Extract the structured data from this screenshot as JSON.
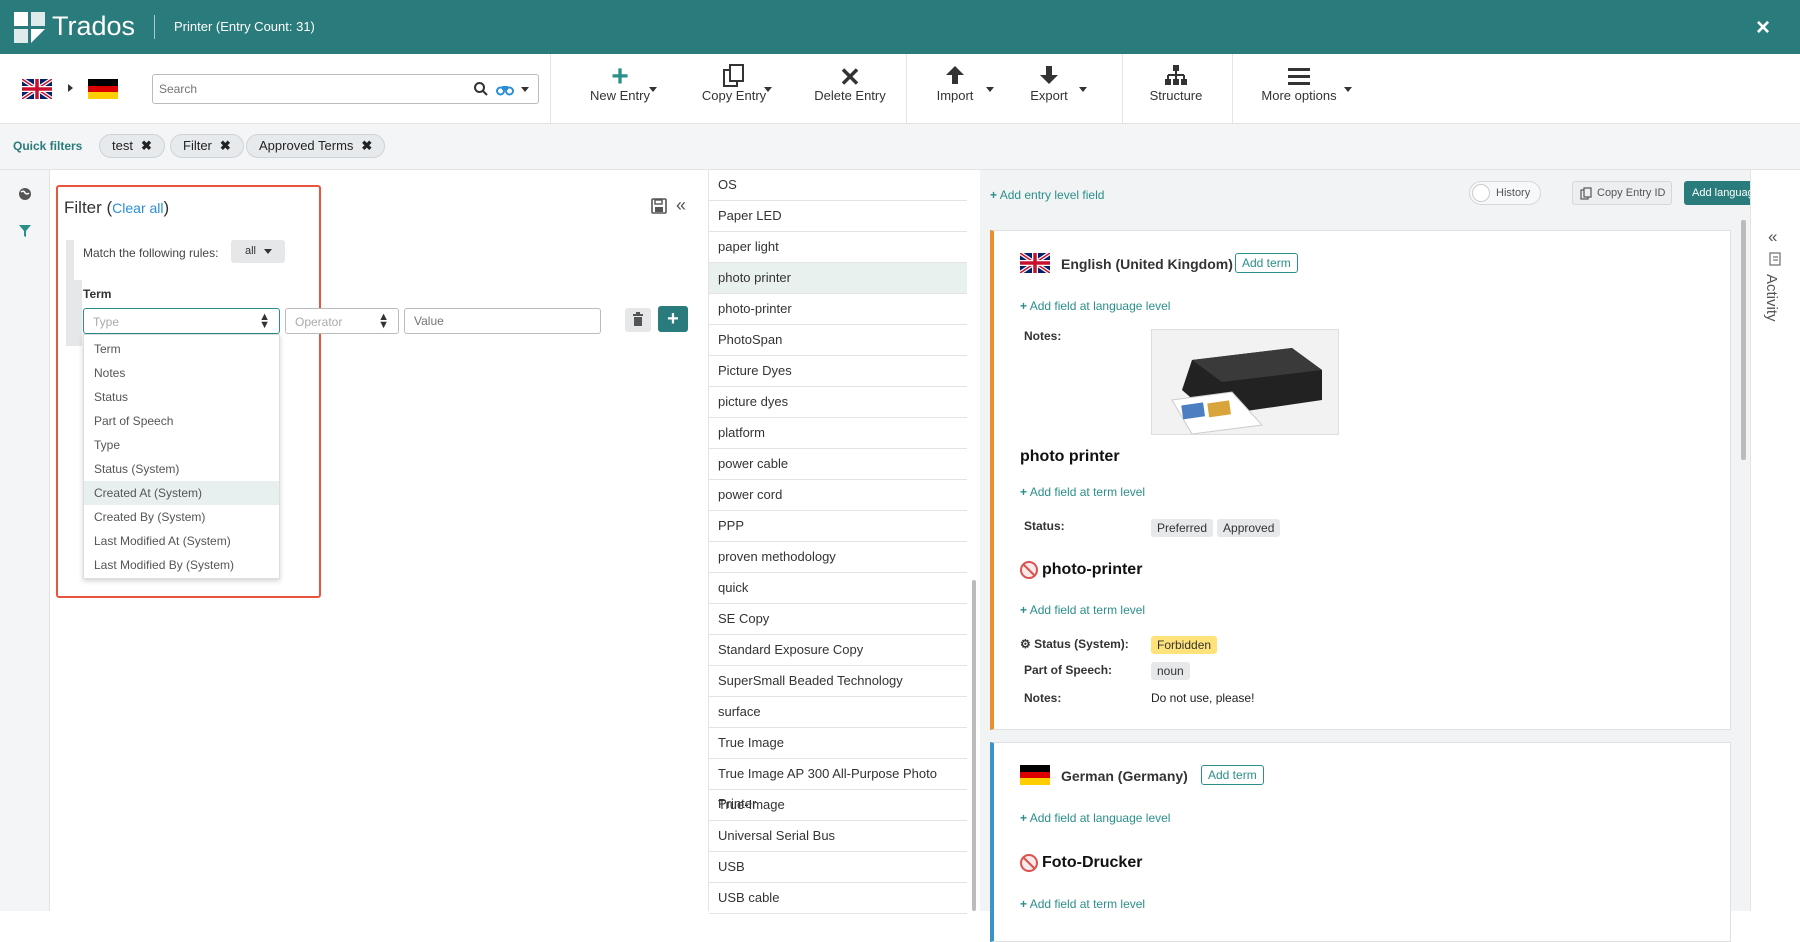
{
  "app": {
    "brand": "Trados",
    "window_title": "Printer (Entry Count: 31)",
    "close": "×"
  },
  "toolbar": {
    "source_flag": "English (United Kingdom)",
    "target_flag": "German (Germany)",
    "search_placeholder": "Search",
    "buttons": {
      "new_entry": "New Entry",
      "copy_entry": "Copy Entry",
      "delete_entry": "Delete Entry",
      "import": "Import",
      "export": "Export",
      "structure": "Structure",
      "more_options": "More options"
    }
  },
  "quick_filters": {
    "label": "Quick filters",
    "chips": [
      "test",
      "Filter",
      "Approved Terms"
    ]
  },
  "filter": {
    "title": "Filter",
    "clear_all": "Clear all",
    "match_label": "Match the following rules:",
    "match_value": "all",
    "group_label": "Term",
    "type_placeholder": "Type",
    "operator_placeholder": "Operator",
    "value_placeholder": "Value",
    "options": [
      "Term",
      "Notes",
      "Status",
      "Part of Speech",
      "Type",
      "Status (System)",
      "Created At (System)",
      "Created By (System)",
      "Last Modified At (System)",
      "Last Modified By (System)"
    ],
    "highlighted_option": "Created At (System)"
  },
  "terms": [
    "OS",
    "Paper LED",
    "paper light",
    "photo printer",
    "photo-printer",
    "PhotoSpan",
    "Picture Dyes",
    "picture dyes",
    "platform",
    "power cable",
    "power cord",
    "PPP",
    "proven methodology",
    "quick",
    "SE Copy",
    "Standard Exposure Copy",
    "SuperSmall Beaded Technology",
    "surface",
    "True Image",
    "True Image AP 300 All-Purpose Photo Printer",
    "True-Image",
    "Universal Serial Bus",
    "USB",
    "USB cable"
  ],
  "selected_term": "photo printer",
  "entry": {
    "add_entry_field": "Add entry level field",
    "history": "History",
    "copy_entry_id": "Copy Entry ID",
    "add_language": "Add language",
    "activity": "Activity",
    "english": {
      "language": "English (United Kingdom)",
      "add_term": "Add term",
      "add_field_lang": "Add field at language level",
      "notes_label": "Notes:",
      "term1": {
        "text": "photo printer",
        "add_field": "Add field at term level",
        "status_label": "Status:",
        "statuses": [
          "Preferred",
          "Approved"
        ]
      },
      "term2": {
        "text": "photo-printer",
        "add_field": "Add field at term level",
        "status_system_label": "Status (System):",
        "status_system_value": "Forbidden",
        "pos_label": "Part of Speech:",
        "pos_value": "noun",
        "notes_label": "Notes:",
        "notes_value": "Do not use, please!"
      }
    },
    "german": {
      "language": "German (Germany)",
      "add_term": "Add term",
      "add_field_lang": "Add field at language level",
      "term1": {
        "text": "Foto-Drucker",
        "add_field": "Add field at term level"
      }
    }
  },
  "colors": {
    "brand": "#2a7b7b",
    "accent": "#2a8f8a",
    "highlight_box": "#e8553e",
    "english_bar": "#e8902e",
    "german_bar": "#3a93c9",
    "forbidden": "#ffe37a"
  }
}
